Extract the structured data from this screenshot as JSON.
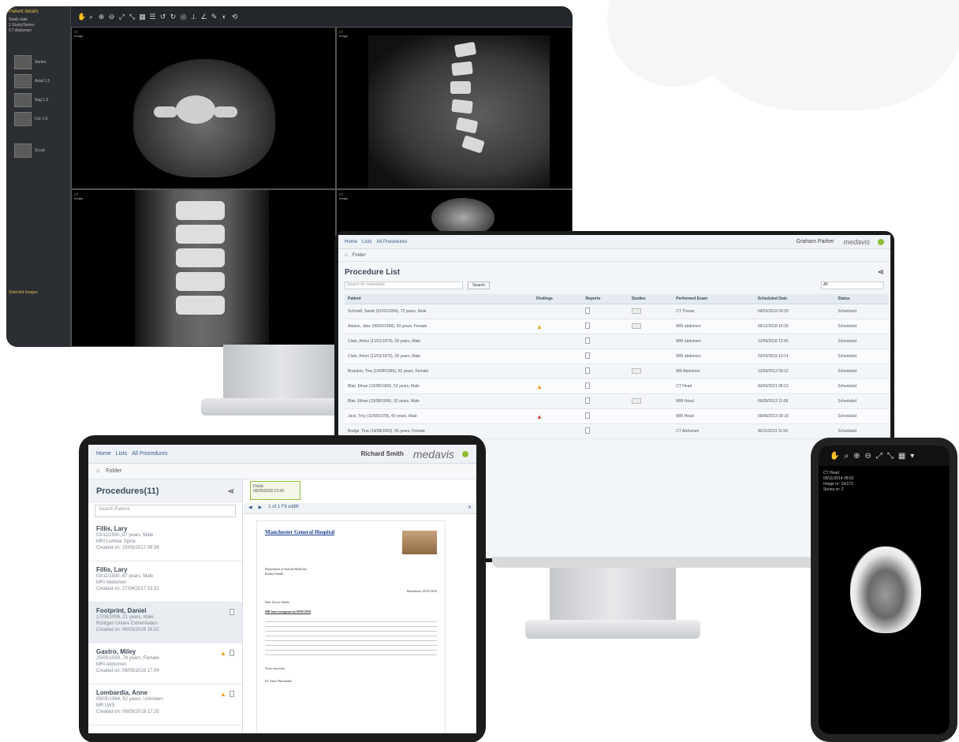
{
  "viewer": {
    "sidebar_title": "Patient details",
    "sidebar_lines": [
      "Study date",
      "1 Study/Series",
      "CT Abdomen"
    ],
    "thumbs": [
      "Series",
      "Axial 1.5",
      "Sag 1.5",
      "Cor 1.5",
      "Scout"
    ],
    "bottom_label": "Selected images"
  },
  "worklist": {
    "breadcrumb": [
      "Home",
      "Lists",
      "All Procedures"
    ],
    "user": "Graham Parker",
    "logo": "medavis",
    "sub": "Folder",
    "title": "Procedure List",
    "search_placeholder": "Search for name/date",
    "search_button": "Search",
    "group_select": "All",
    "columns": [
      "Patient",
      "Findings",
      "Reports",
      "Studies",
      "Performed Exam",
      "Scheduled Date",
      "Status"
    ],
    "rows": [
      {
        "patient": "Schmidt, Sarah (01/02/1954), 72 years, Male",
        "warn": "",
        "exam": "CT Thorax",
        "date": "09/03/2019 09:30",
        "status": "Scheduled"
      },
      {
        "patient": "Adams, Jane (08/06/1968), 50 years, Female",
        "warn": "yellow",
        "exam": "MRI abdomen",
        "date": "09/12/2018 15:30",
        "status": "Scheduled"
      },
      {
        "patient": "Clark, Anton (11/01/1979), 39 years, Male",
        "warn": "",
        "exam": "MRI abdomen",
        "date": "12/09/2018 12:42",
        "status": "Scheduled"
      },
      {
        "patient": "Clark, Anton (11/01/1979), 39 years, Male",
        "warn": "",
        "exam": "MRI abdomen",
        "date": "29/03/2019 10:14",
        "status": "Scheduled"
      },
      {
        "patient": "Brandon, Tina (14/08/1966), 52 years, Female",
        "warn": "",
        "exam": "MR Abdomen",
        "date": "13/09/2012 09:12",
        "status": "Scheduled"
      },
      {
        "patient": "Blair, Ethan (13/08/1966), 52 years, Male",
        "warn": "yellow",
        "exam": "CT Head",
        "date": "30/09/2021 08:12",
        "status": "Scheduled"
      },
      {
        "patient": "Blair, Ethan (13/08/1966), 52 years, Male",
        "warn": "",
        "exam": "MRI Head",
        "date": "06/09/2013 11:08",
        "status": "Scheduled"
      },
      {
        "patient": "Jack, Troy (11/08/1978), 40 years, Male",
        "warn": "red",
        "exam": "MRI Head",
        "date": "09/09/2013 09:18",
        "status": "Scheduled"
      },
      {
        "patient": "Bodge, Tina (14/08/1963), 55 years, Female",
        "warn": "",
        "exam": "CT Abdomen",
        "date": "30/11/2013 11:50",
        "status": "Scheduled"
      }
    ]
  },
  "tablet": {
    "breadcrumb": [
      "Home",
      "Lists",
      "All Procedures"
    ],
    "user": "Richard Smith",
    "logo": "medavis",
    "sub": "Folder",
    "list_title": "Procedures(11)",
    "search_placeholder": "Search Patient",
    "items": [
      {
        "name": "Fillis, Lary",
        "l1": "03/11/1930, 87 years, Male",
        "l2": "MRI Lumbar Spine",
        "l3": "Created on: 25/05/2017 09:36"
      },
      {
        "name": "Fillis, Lary",
        "l1": "03/11/1930, 87 years, Male",
        "l2": "MRI Abdomen",
        "l3": "Created on: 27/04/2017 15:32"
      },
      {
        "name": "Footprint, Daniel",
        "l1": "17/05/1996, 21 years, Male",
        "l2": "Rontgen Untere Extremitaten",
        "l3": "Created on: 06/03/2018 16:02"
      },
      {
        "name": "Gastro, Miley",
        "l1": "25/05/1939, 78 years, Female",
        "l2": "MRI Abdomen",
        "l3": "Created on: 08/05/2018 17:04"
      },
      {
        "name": "Lombardia, Anne",
        "l1": "09/05/1964, 52 years, Unknown",
        "l2": "MR LWS",
        "l3": "Created on: 09/05/2018 17:25"
      }
    ],
    "note_title": "Dictat",
    "note_date": "09/05/2018 13:43",
    "pdf_bar": "1 of 1   Fit width",
    "letter": {
      "hospital": "Manchester General Hospital",
      "dept": "Department of Internal Medicine",
      "sender": "Richard Smith",
      "date": "Manchester, 09.05.2018",
      "salutation": "Dear Doctor Smith,",
      "heading": "MR knee sonogram on 09/05/2018",
      "closing": "Yours sincerely,",
      "signature": "Dr. Vance Hernandez"
    }
  },
  "phone": {
    "overlay": [
      "CT Head",
      "09/11/2014 08:52",
      "Image nr: 19/171",
      "Series nr: 2"
    ]
  }
}
